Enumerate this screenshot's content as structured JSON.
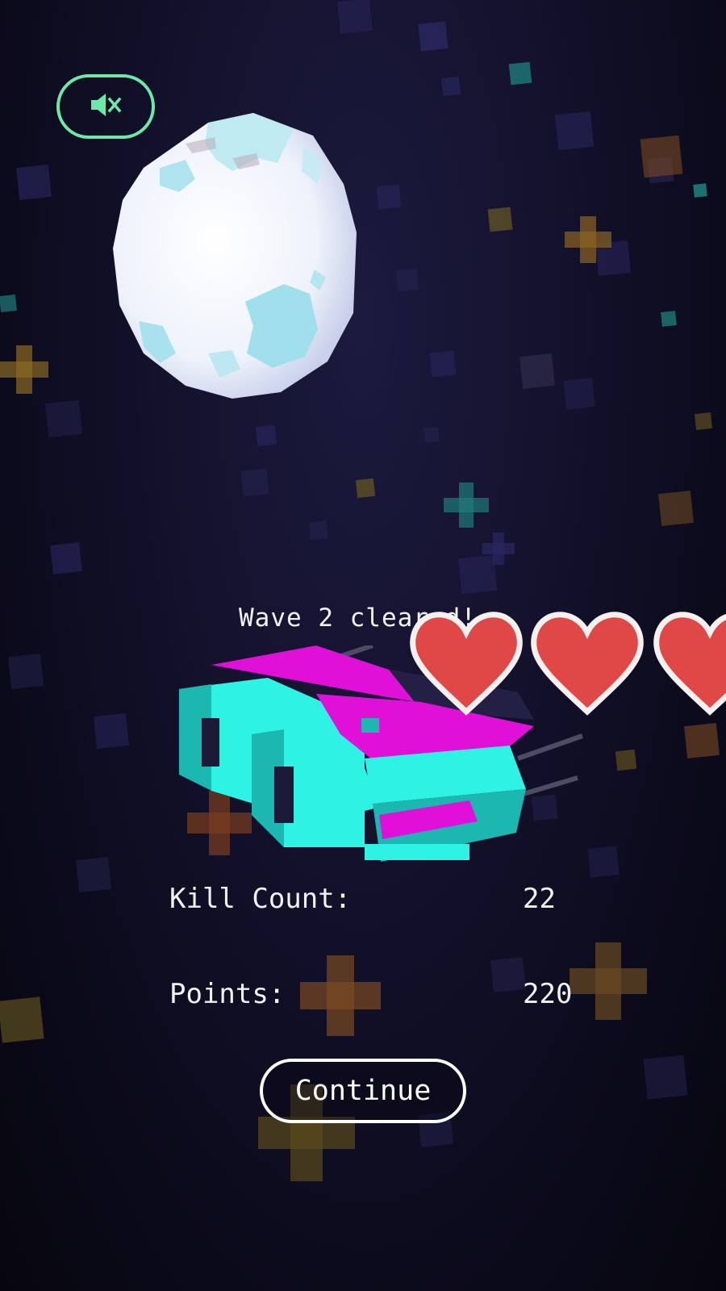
{
  "colors": {
    "accent": "#6ee8a6",
    "text": "#f1f1f4",
    "heart": "#e04848",
    "heart_outline": "#f4f0f0",
    "ship_primary": "#2ef3e4",
    "ship_secondary": "#e010d8"
  },
  "hud": {
    "sound_toggle_icon": "speaker-muted-icon",
    "hearts_visible": 3
  },
  "wave": {
    "message": "Wave 2 cleared!"
  },
  "stats": {
    "kill_count_label": "Kill Count:",
    "kill_count_value": "22",
    "points_label": "Points:",
    "points_value": "220"
  },
  "actions": {
    "continue_label": "Continue"
  }
}
